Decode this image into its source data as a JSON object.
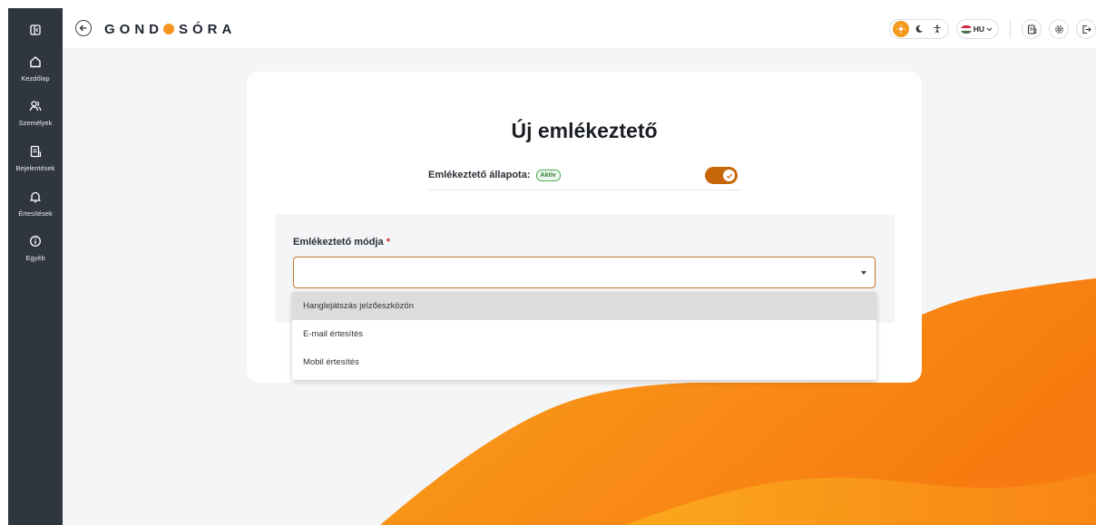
{
  "app": {
    "logo_left": "GOND",
    "logo_right": "SÓRA"
  },
  "sidebar": {
    "items": [
      {
        "label": "Kezdőlap",
        "icon": "home-icon"
      },
      {
        "label": "Személyek",
        "icon": "users-icon"
      },
      {
        "label": "Bejelentések",
        "icon": "report-icon"
      },
      {
        "label": "Értesítések",
        "icon": "bell-icon"
      },
      {
        "label": "Egyéb",
        "icon": "info-icon"
      }
    ]
  },
  "topbar": {
    "language": "HU",
    "theme_active": "light"
  },
  "form": {
    "title": "Új emlékeztető",
    "status_label": "Emlékeztető állapota:",
    "status_badge": "Aktív",
    "toggle_on": true,
    "mode_label": "Emlékeztető módja",
    "required_mark": "*",
    "mode_value": ""
  },
  "dropdown": {
    "options": [
      {
        "label": "Hanglejátszás jelzőeszközön",
        "highlighted": true
      },
      {
        "label": "E-mail értesítés",
        "highlighted": false
      },
      {
        "label": "Mobil értesítés",
        "highlighted": false
      }
    ]
  },
  "colors": {
    "accent": "#f39a1f",
    "toggle": "#c8670a",
    "sidebar": "#2f3640",
    "badge_green": "#4caf50"
  }
}
